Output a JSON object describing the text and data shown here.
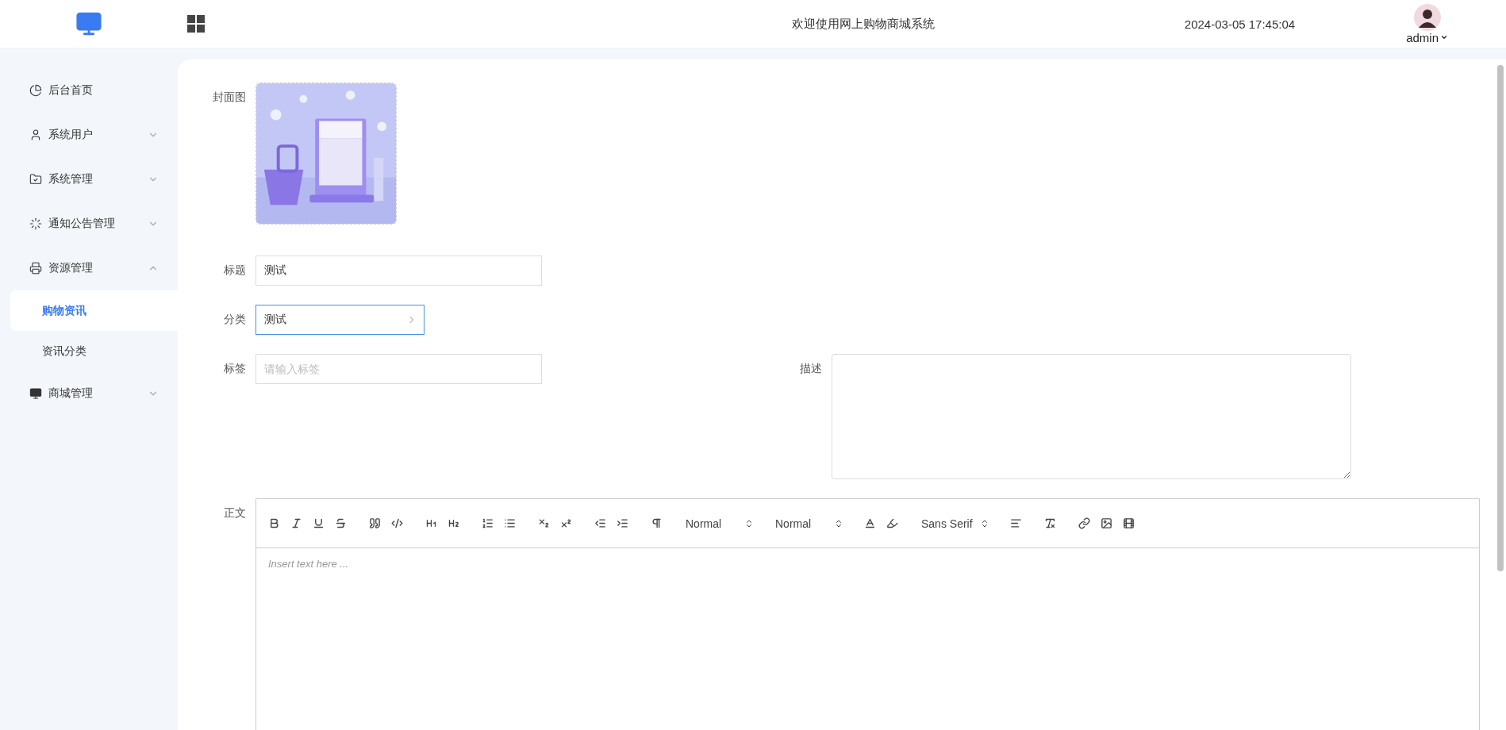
{
  "header": {
    "title": "欢迎使用网上购物商城系统",
    "datetime": "2024-03-05 17:45:04",
    "user": "admin"
  },
  "sidebar": {
    "items": [
      {
        "label": "后台首页"
      },
      {
        "label": "系统用户",
        "expanded": false
      },
      {
        "label": "系统管理",
        "expanded": false
      },
      {
        "label": "通知公告管理",
        "expanded": false
      },
      {
        "label": "资源管理",
        "expanded": true,
        "children": [
          {
            "label": "购物资讯",
            "selected": true
          },
          {
            "label": "资讯分类",
            "selected": false
          }
        ]
      },
      {
        "label": "商城管理",
        "expanded": false
      }
    ]
  },
  "form": {
    "cover": {
      "label": "封面图",
      "kind": "picture"
    },
    "title": {
      "label": "标题",
      "value": "测试"
    },
    "category": {
      "label": "分类",
      "value": "测试",
      "focused": true
    },
    "tags": {
      "label": "标签",
      "placeholder": "请输入标签"
    },
    "description": {
      "label": "描述"
    },
    "content": {
      "label": "正文",
      "pickers": [
        "Normal",
        "Normal",
        "Sans Serif"
      ],
      "placeholder": "Insert text here ..."
    }
  }
}
